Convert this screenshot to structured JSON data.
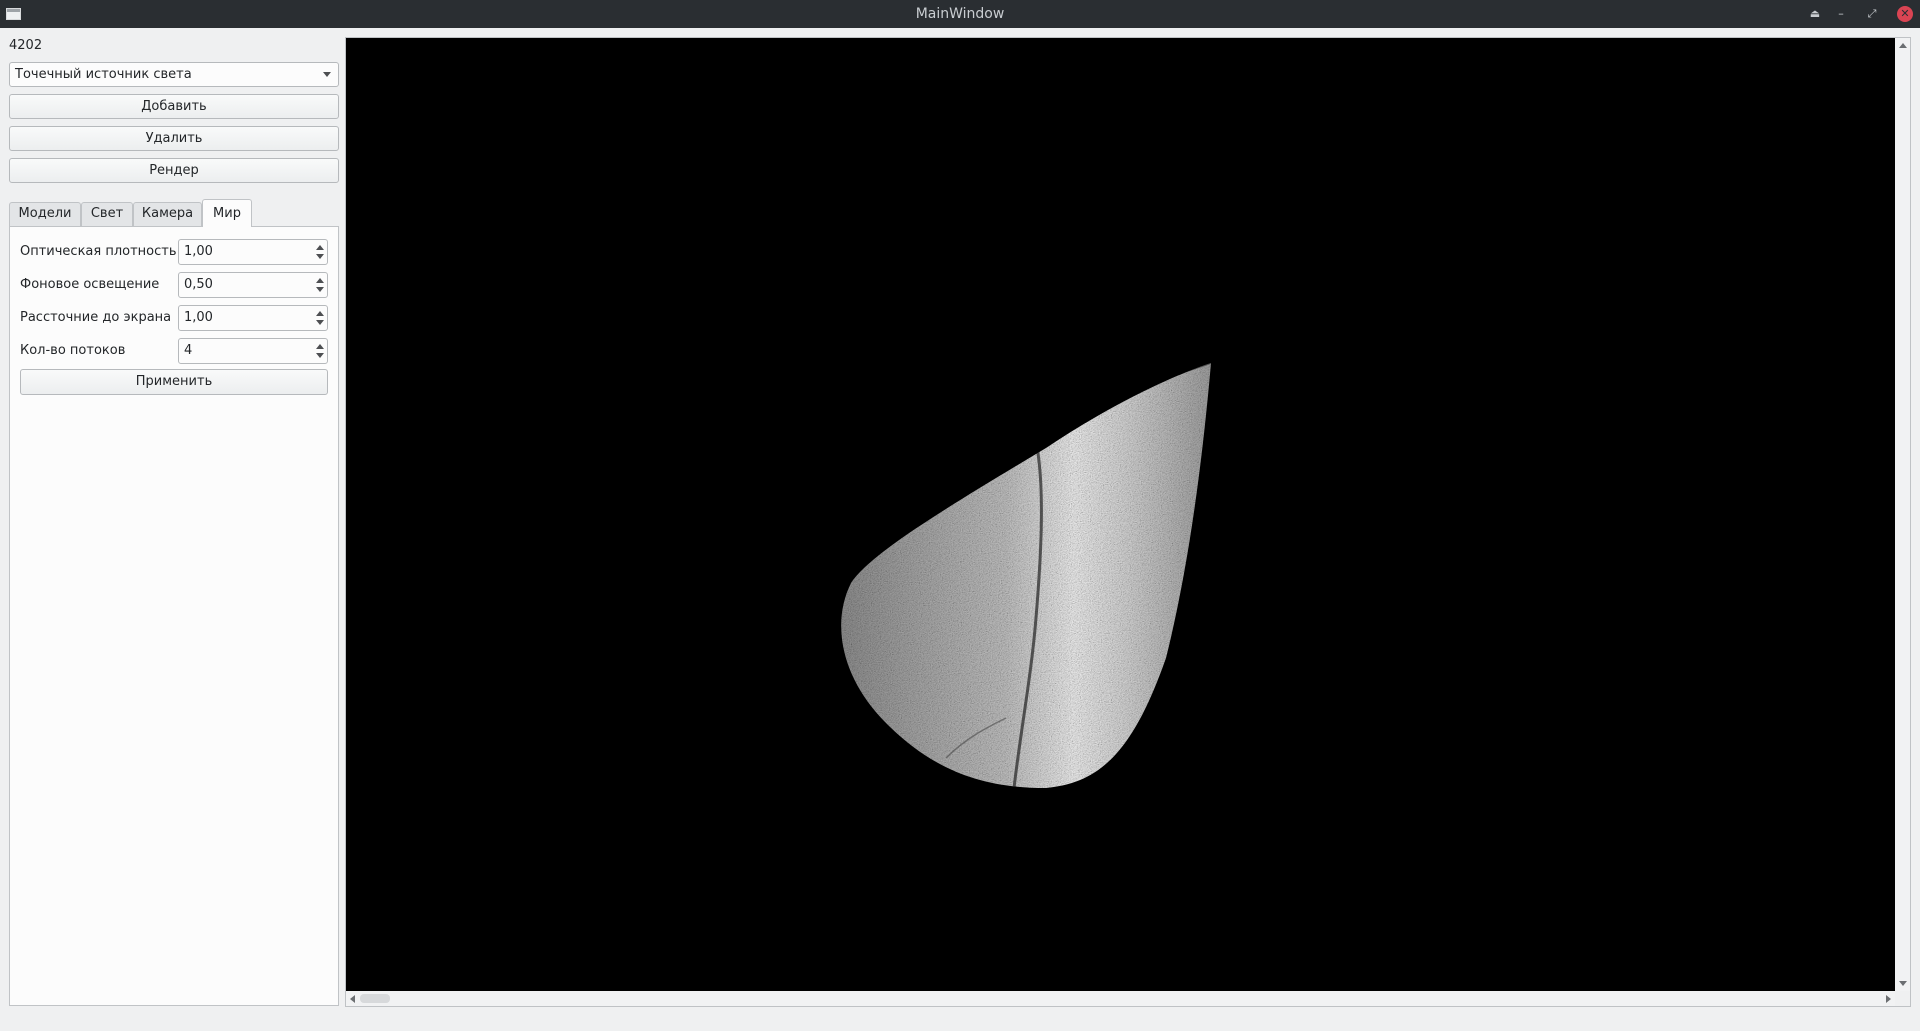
{
  "window": {
    "title": "MainWindow",
    "buttons": [
      "keep-above",
      "minimize",
      "maximize",
      "close"
    ]
  },
  "left_panel": {
    "id_value": "4202",
    "object_type": {
      "selected": "Точечный источник света"
    },
    "buttons": {
      "add": "Добавить",
      "delete": "Удалить",
      "render": "Рендер"
    },
    "tabs": [
      {
        "label": "Модели",
        "active": false
      },
      {
        "label": "Свет",
        "active": false
      },
      {
        "label": "Камера",
        "active": false
      },
      {
        "label": "Мир",
        "active": true
      }
    ],
    "world": {
      "optical_density": {
        "label": "Оптическая плотность",
        "value": "1,00"
      },
      "ambient_light": {
        "label": "Фоновое освещение",
        "value": "0,50"
      },
      "screen_distance": {
        "label": "Рассточние до экрана",
        "value": "1,00"
      },
      "threads": {
        "label": "Кол-во потоков",
        "value": "4"
      },
      "apply_label": "Применить"
    }
  },
  "viewport": {
    "background": "#000000",
    "content": "textured-cone",
    "h_scroll_position": 0,
    "v_scroll_position": 0
  }
}
